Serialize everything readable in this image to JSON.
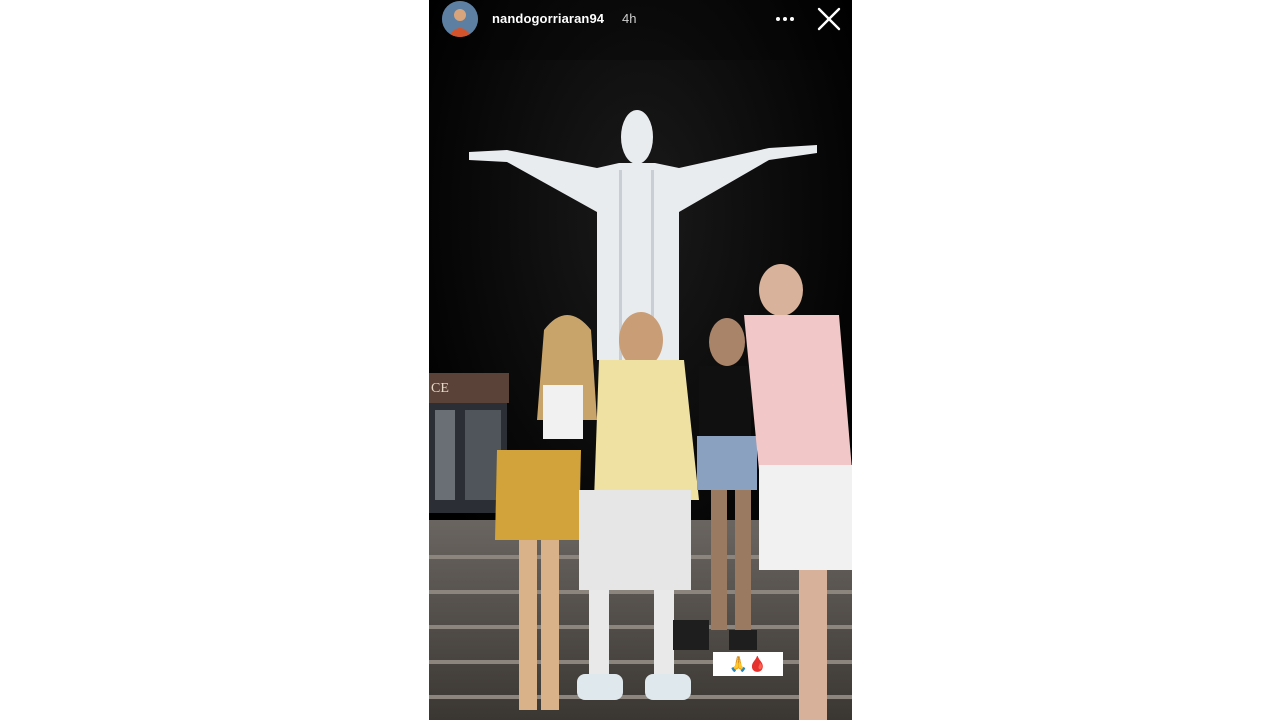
{
  "story": {
    "username": "nandogorriaran94",
    "timestamp": "4h",
    "sticker_text": "🙏🩸"
  },
  "icons": {
    "more": "more-options-icon",
    "close": "close-icon"
  },
  "colors": {
    "background": "#ffffff",
    "story_background": "#000000",
    "header_text": "#ffffff"
  }
}
